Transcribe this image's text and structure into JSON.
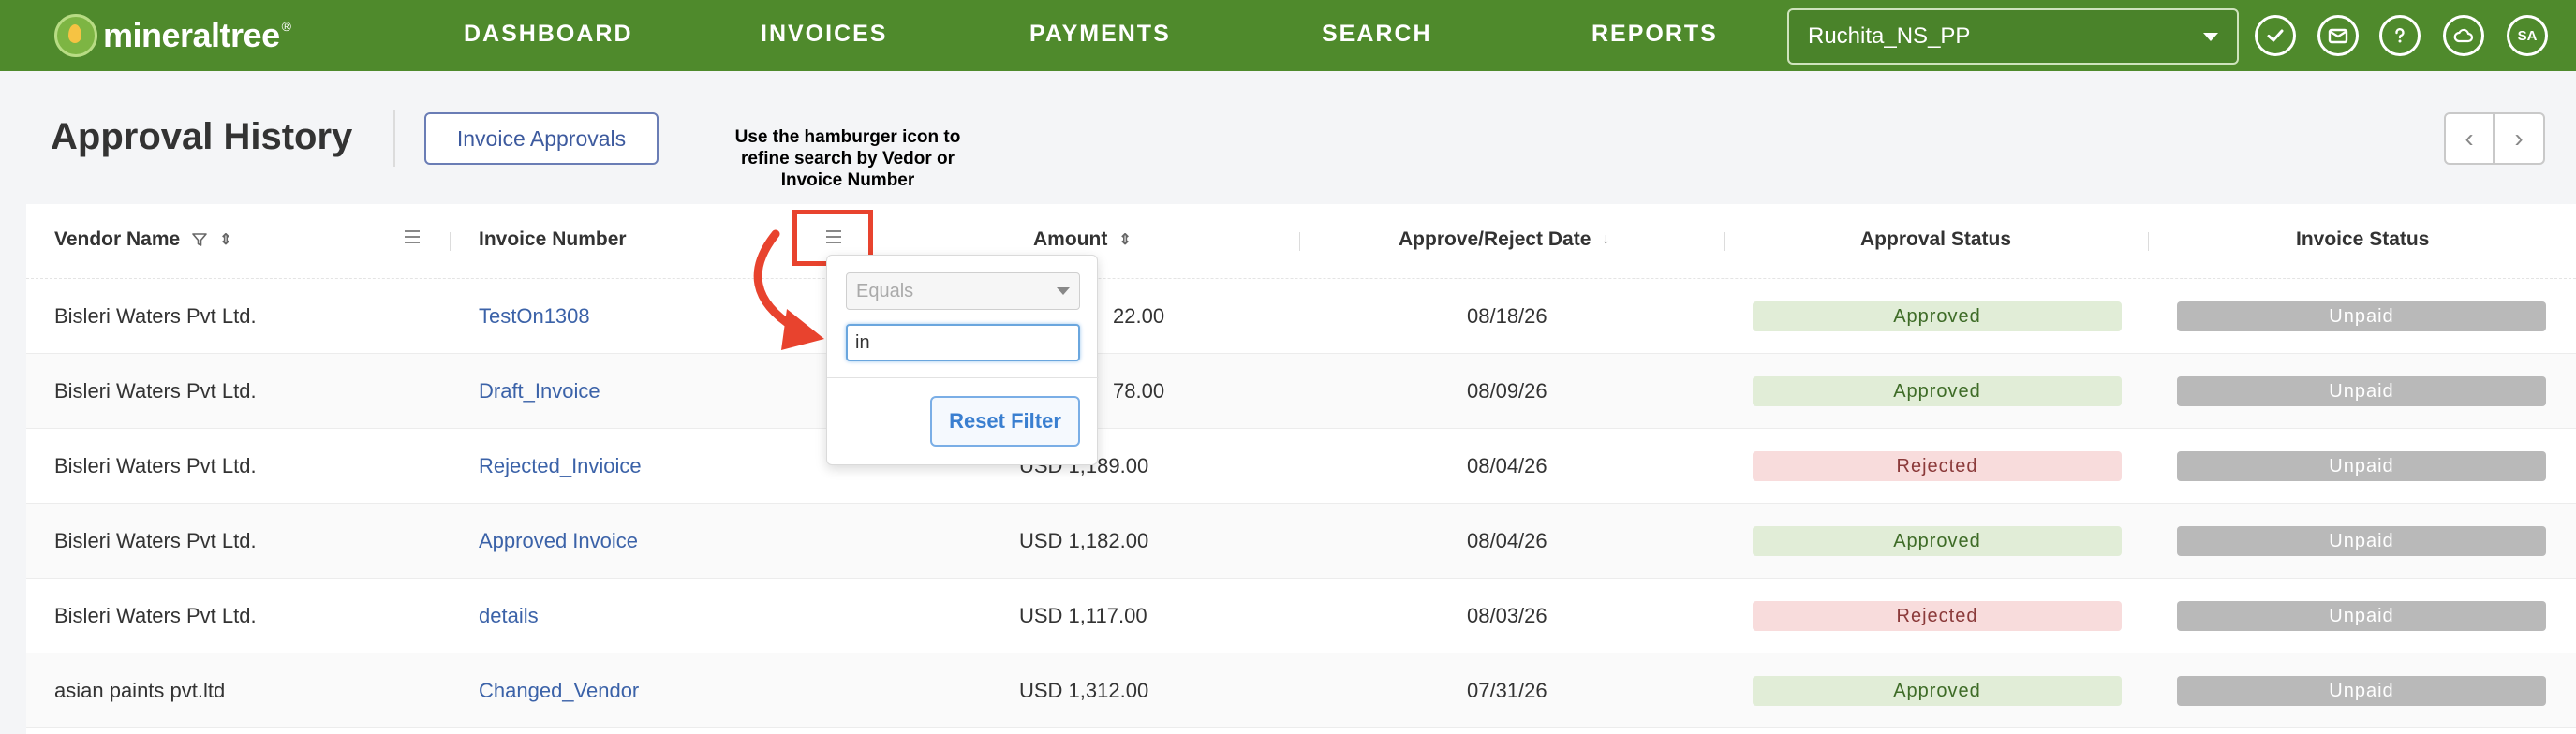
{
  "nav": {
    "logo_text": "mineraltree",
    "logo_tm": "®",
    "links": [
      "DASHBOARD",
      "INVOICES",
      "PAYMENTS",
      "SEARCH",
      "REPORTS"
    ],
    "org_selected": "Ruchita_NS_PP",
    "icons": [
      "check-circle-icon",
      "mail-icon",
      "help-icon",
      "cloud-icon"
    ],
    "avatar_initials": "SA"
  },
  "header": {
    "title": "Approval History",
    "invoice_approvals_label": "Invoice Approvals",
    "prev_glyph": "‹",
    "next_glyph": "›"
  },
  "annotation": "Use the hamburger icon to refine search by Vedor or Invoice Number",
  "table": {
    "columns": [
      "Vendor Name",
      "Invoice Number",
      "Amount",
      "Approve/Reject Date",
      "Approval Status",
      "Invoice Status"
    ],
    "rows": [
      {
        "vendor": "Bisleri Waters Pvt Ltd.",
        "invoice": "TestOn1308",
        "amount": "22.00",
        "date": "08/18/26",
        "approval": "Approved",
        "status": "Unpaid"
      },
      {
        "vendor": "Bisleri Waters Pvt Ltd.",
        "invoice": "Draft_Invoice",
        "amount": "78.00",
        "date": "08/09/26",
        "approval": "Approved",
        "status": "Unpaid"
      },
      {
        "vendor": "Bisleri Waters Pvt Ltd.",
        "invoice": "Rejected_Invioice",
        "amount": "USD 1,189.00",
        "date": "08/04/26",
        "approval": "Rejected",
        "status": "Unpaid"
      },
      {
        "vendor": "Bisleri Waters Pvt Ltd.",
        "invoice": "Approved Invoice",
        "amount": "USD 1,182.00",
        "date": "08/04/26",
        "approval": "Approved",
        "status": "Unpaid"
      },
      {
        "vendor": "Bisleri Waters Pvt Ltd.",
        "invoice": "details",
        "amount": "USD 1,117.00",
        "date": "08/03/26",
        "approval": "Rejected",
        "status": "Unpaid"
      },
      {
        "vendor": "asian paints pvt.ltd",
        "invoice": "Changed_Vendor",
        "amount": "USD 1,312.00",
        "date": "07/31/26",
        "approval": "Approved",
        "status": "Unpaid"
      }
    ]
  },
  "filter_popup": {
    "operator_selected": "Equals",
    "input_value": "in",
    "reset_label": "Reset Filter"
  },
  "colors": {
    "nav_bg": "#4f8a2c",
    "link": "#3b62a8",
    "approved_bg": "#e1edd7",
    "rejected_bg": "#f8dcdc",
    "unpaid_bg": "#b9b9b9",
    "annotation_red": "#e8432e"
  }
}
